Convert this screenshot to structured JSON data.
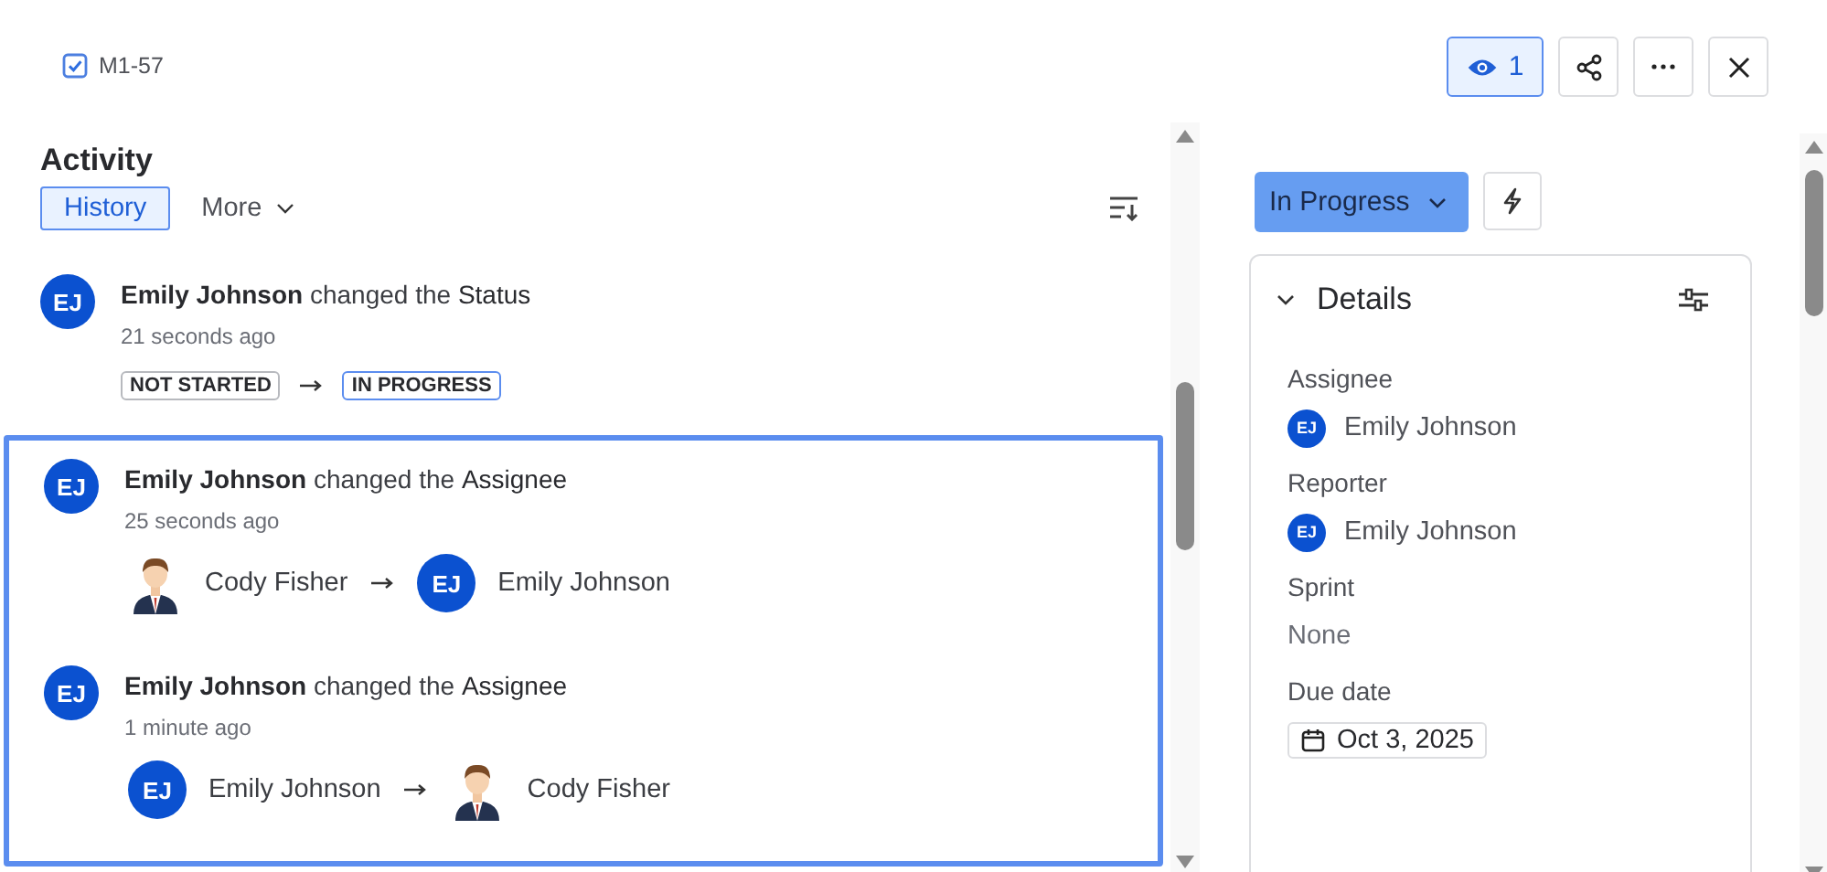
{
  "header": {
    "issue_key": "M1-57",
    "watchers": "1",
    "watching": true
  },
  "activity": {
    "title": "Activity",
    "tabs": [
      {
        "label": "History",
        "selected": true,
        "has_menu": false
      },
      {
        "label": "More",
        "selected": false,
        "has_menu": true
      }
    ],
    "entries": [
      {
        "avatar": "EJ",
        "actor": "Emily Johnson",
        "action": "changed the",
        "field": "Status",
        "time": "21 seconds ago",
        "kind": "status",
        "from": "NOT STARTED",
        "to": "IN PROGRESS",
        "highlighted": false
      },
      {
        "avatar": "EJ",
        "actor": "Emily Johnson",
        "action": "changed the",
        "field": "Assignee",
        "time": "25 seconds ago",
        "kind": "assignee",
        "from": {
          "kind": "figure",
          "name": "Cody Fisher"
        },
        "to": {
          "kind": "initials",
          "initials": "EJ",
          "name": "Emily Johnson"
        },
        "highlighted": true
      },
      {
        "avatar": "EJ",
        "actor": "Emily Johnson",
        "action": "changed the",
        "field": "Assignee",
        "time": "1 minute ago",
        "kind": "assignee",
        "from": {
          "kind": "initials",
          "initials": "EJ",
          "name": "Emily Johnson"
        },
        "to": {
          "kind": "figure",
          "name": "Cody Fisher"
        },
        "highlighted": true
      }
    ]
  },
  "details": {
    "status": "In Progress",
    "title": "Details",
    "expanded": true,
    "fields": [
      {
        "label": "Assignee",
        "kind": "person",
        "initials": "EJ",
        "value": "Emily Johnson"
      },
      {
        "label": "Reporter",
        "kind": "person",
        "initials": "EJ",
        "value": "Emily Johnson"
      },
      {
        "label": "Sprint",
        "kind": "text",
        "value": "None"
      },
      {
        "label": "Due date",
        "kind": "date",
        "value": "Oct 3, 2025"
      }
    ]
  }
}
